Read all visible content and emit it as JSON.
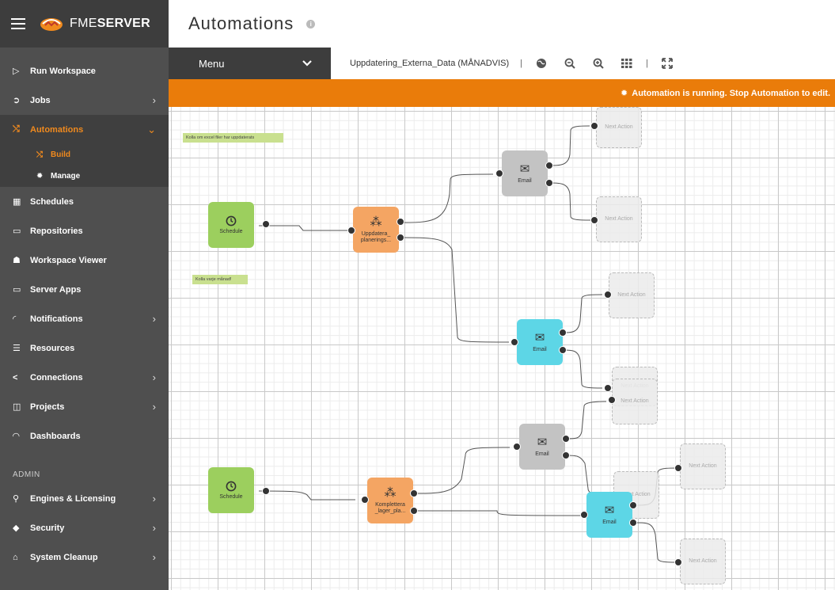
{
  "app": {
    "brand_light": "FME",
    "brand_bold": "SERVER"
  },
  "sidebar": {
    "items": [
      {
        "label": "Run Workspace",
        "icon": "play-icon",
        "glyph": "▷",
        "chevron": false
      },
      {
        "label": "Jobs",
        "icon": "jobs-icon",
        "glyph": "➲",
        "chevron": true
      },
      {
        "label": "Automations",
        "icon": "shuffle-icon",
        "glyph": "⤭",
        "chevron": true,
        "active": true
      }
    ],
    "sub_items": [
      {
        "label": "Build",
        "icon": "shuffle-icon",
        "glyph": "⤭",
        "current": true
      },
      {
        "label": "Manage",
        "icon": "gear-icon",
        "glyph": "✹",
        "current": false
      }
    ],
    "items2": [
      {
        "label": "Schedules",
        "icon": "calendar-icon",
        "glyph": "▦",
        "chevron": false
      },
      {
        "label": "Repositories",
        "icon": "folder-icon",
        "glyph": "▭",
        "chevron": false
      },
      {
        "label": "Workspace Viewer",
        "icon": "binoculars-icon",
        "glyph": "☗",
        "chevron": false
      },
      {
        "label": "Server Apps",
        "icon": "monitor-icon",
        "glyph": "▭",
        "chevron": false
      },
      {
        "label": "Notifications",
        "icon": "rss-icon",
        "glyph": "◜",
        "chevron": true
      },
      {
        "label": "Resources",
        "icon": "database-icon",
        "glyph": "☰",
        "chevron": false
      },
      {
        "label": "Connections",
        "icon": "share-icon",
        "glyph": "<",
        "chevron": true
      },
      {
        "label": "Projects",
        "icon": "book-icon",
        "glyph": "◫",
        "chevron": true
      },
      {
        "label": "Dashboards",
        "icon": "gauge-icon",
        "glyph": "◠",
        "chevron": false
      }
    ],
    "admin_label": "ADMIN",
    "admin_items": [
      {
        "label": "Engines & Licensing",
        "icon": "key-icon",
        "glyph": "⚲",
        "chevron": true
      },
      {
        "label": "Security",
        "icon": "shield-icon",
        "glyph": "◆",
        "chevron": true
      },
      {
        "label": "System Cleanup",
        "icon": "trash-icon",
        "glyph": "⌂",
        "chevron": true
      }
    ]
  },
  "header": {
    "title": "Automations"
  },
  "toolbar": {
    "menu_label": "Menu",
    "automation_name": "Uppdatering_Externa_Data (MÅNADVIS)"
  },
  "banner": {
    "text": "Automation is running. Stop Automation to edit."
  },
  "canvas": {
    "notes": {
      "excel": "Kolla om excel filer har uppdaterats",
      "monthly": "Kolla varje månad!"
    },
    "nodes": {
      "schedule": "Schedule",
      "workspace1": [
        "Uppdatera_",
        "planerings..."
      ],
      "workspace2": [
        "Komplettera",
        "_lager_pla..."
      ],
      "email": "Email",
      "next_action": "Next Action"
    }
  },
  "colors": {
    "accent": "#ea7c0a",
    "schedule": "#9ccf5e",
    "workspace": "#f4a563",
    "email_blue": "#5dd6e6",
    "email_grey": "#c3c3c3"
  }
}
